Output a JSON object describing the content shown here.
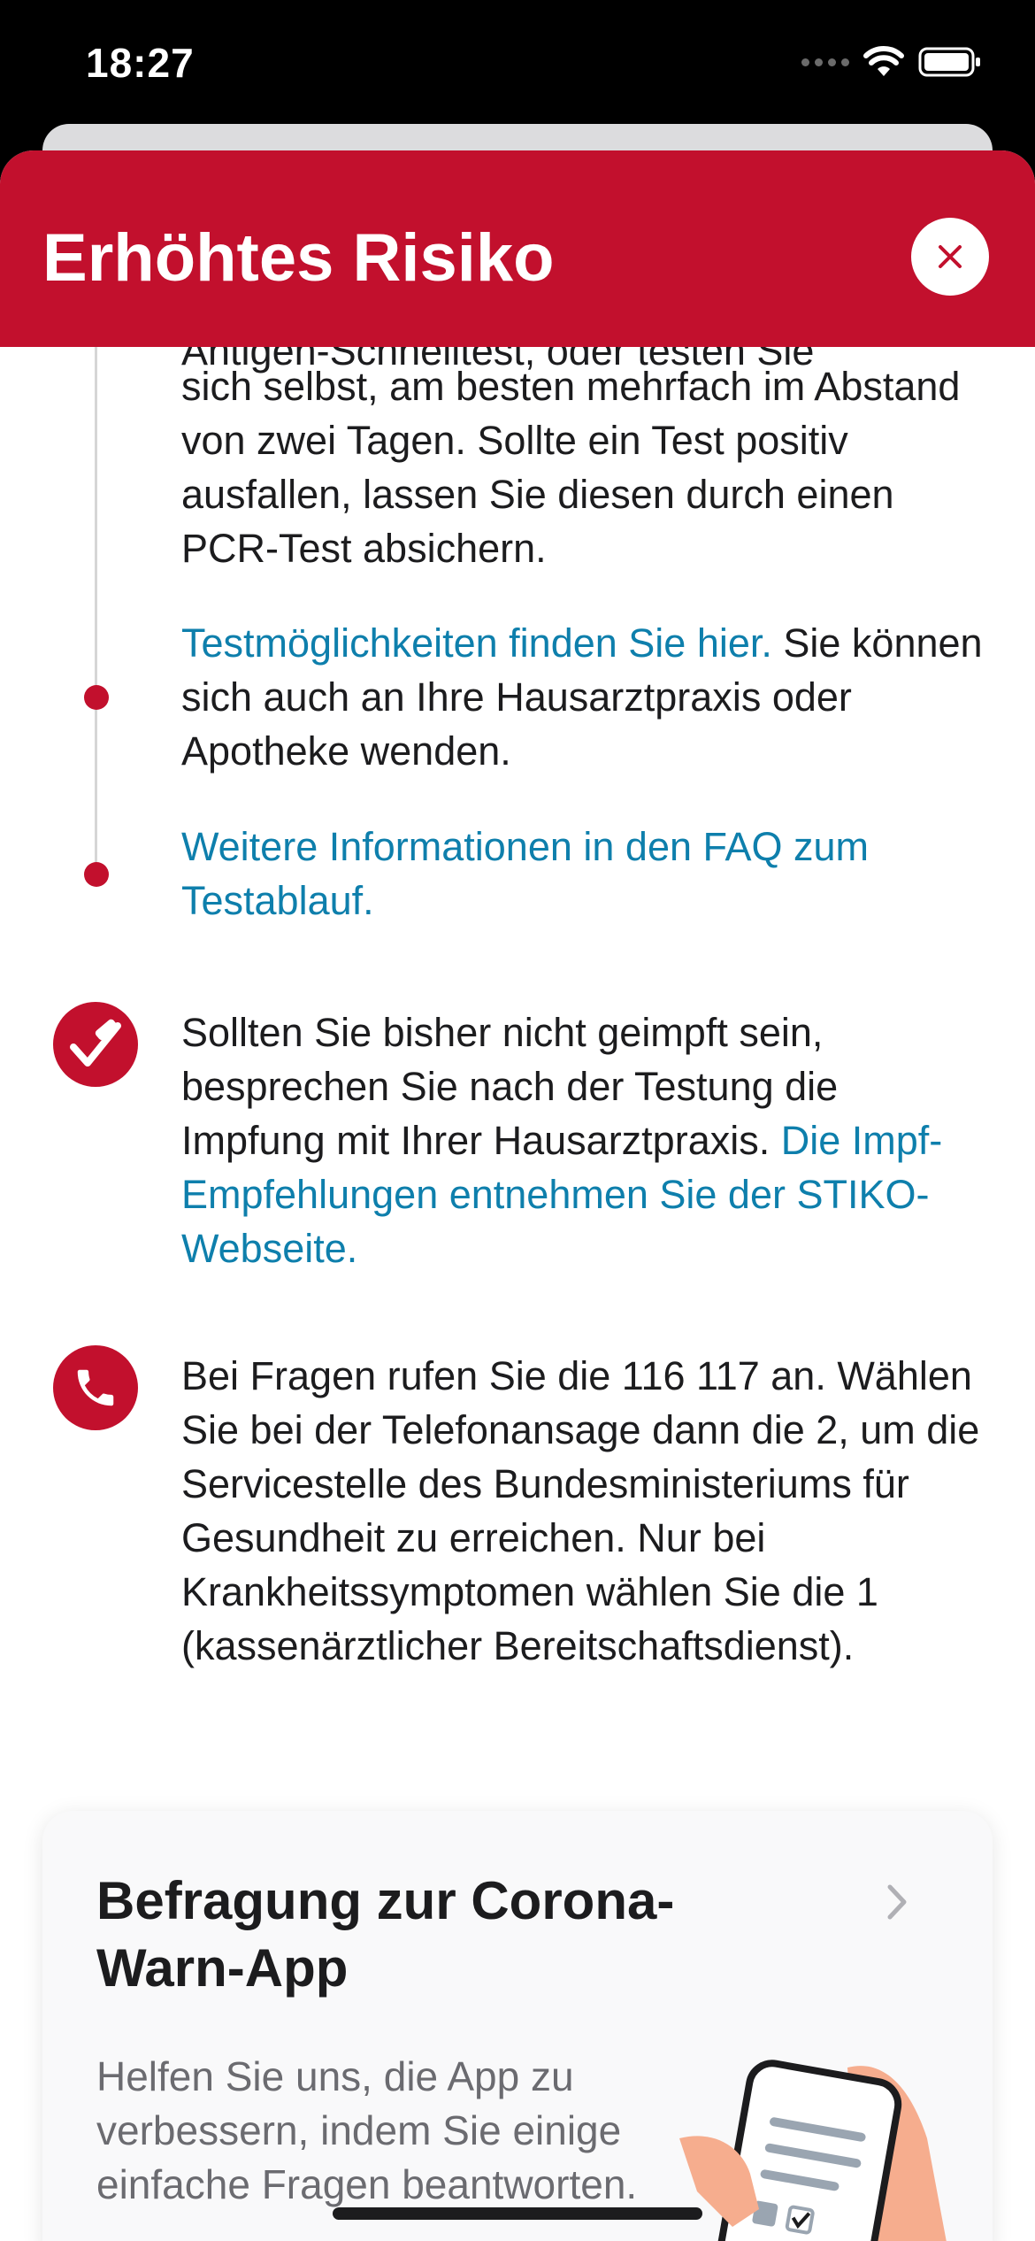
{
  "status_bar": {
    "time": "18:27"
  },
  "header": {
    "title": "Erhöhtes Risiko",
    "close_icon": "close-icon"
  },
  "steps": {
    "clipped_text": "Antigen-Schnelltest, oder testen Sie",
    "test_text": "sich selbst, am besten mehrfach im Abstand von zwei Tagen. Sollte ein Test positiv ausfallen, lassen Sie diesen durch einen PCR-Test absichern.",
    "test_options_link": "Testmöglichkeiten finden Sie hier.",
    "test_options_text": " Sie können sich auch an Ihre Hausarztpraxis oder Apotheke wenden.",
    "faq_link": "Weitere Informationen in den FAQ zum Testablauf."
  },
  "vaccination": {
    "text": "Sollten Sie bisher nicht geimpft sein, besprechen Sie nach der Testung die Impfung mit Ihrer Hausarztpraxis. ",
    "link": "Die Impf-Empfehlungen entnehmen Sie der STIKO-Webseite.",
    "icon": "vaccination-icon"
  },
  "hotline": {
    "text": "Bei Fragen rufen Sie die 116 117 an. Wählen Sie bei der Telefonansage dann die 2, um die Servicestelle des Bundesministeriums für Gesundheit zu erreichen. Nur bei Krankheitssymptomen wählen Sie die 1 (kassenärztlicher Bereitschaftsdienst).",
    "icon": "phone-icon"
  },
  "survey_card": {
    "title": "Befragung zur Corona-Warn-App",
    "description": "Helfen Sie uns, die App zu verbessern, indem Sie einige einfache Fragen beantworten."
  },
  "colors": {
    "accent": "#c2102d",
    "link": "#0e7fac",
    "text": "#1c1c1e"
  }
}
